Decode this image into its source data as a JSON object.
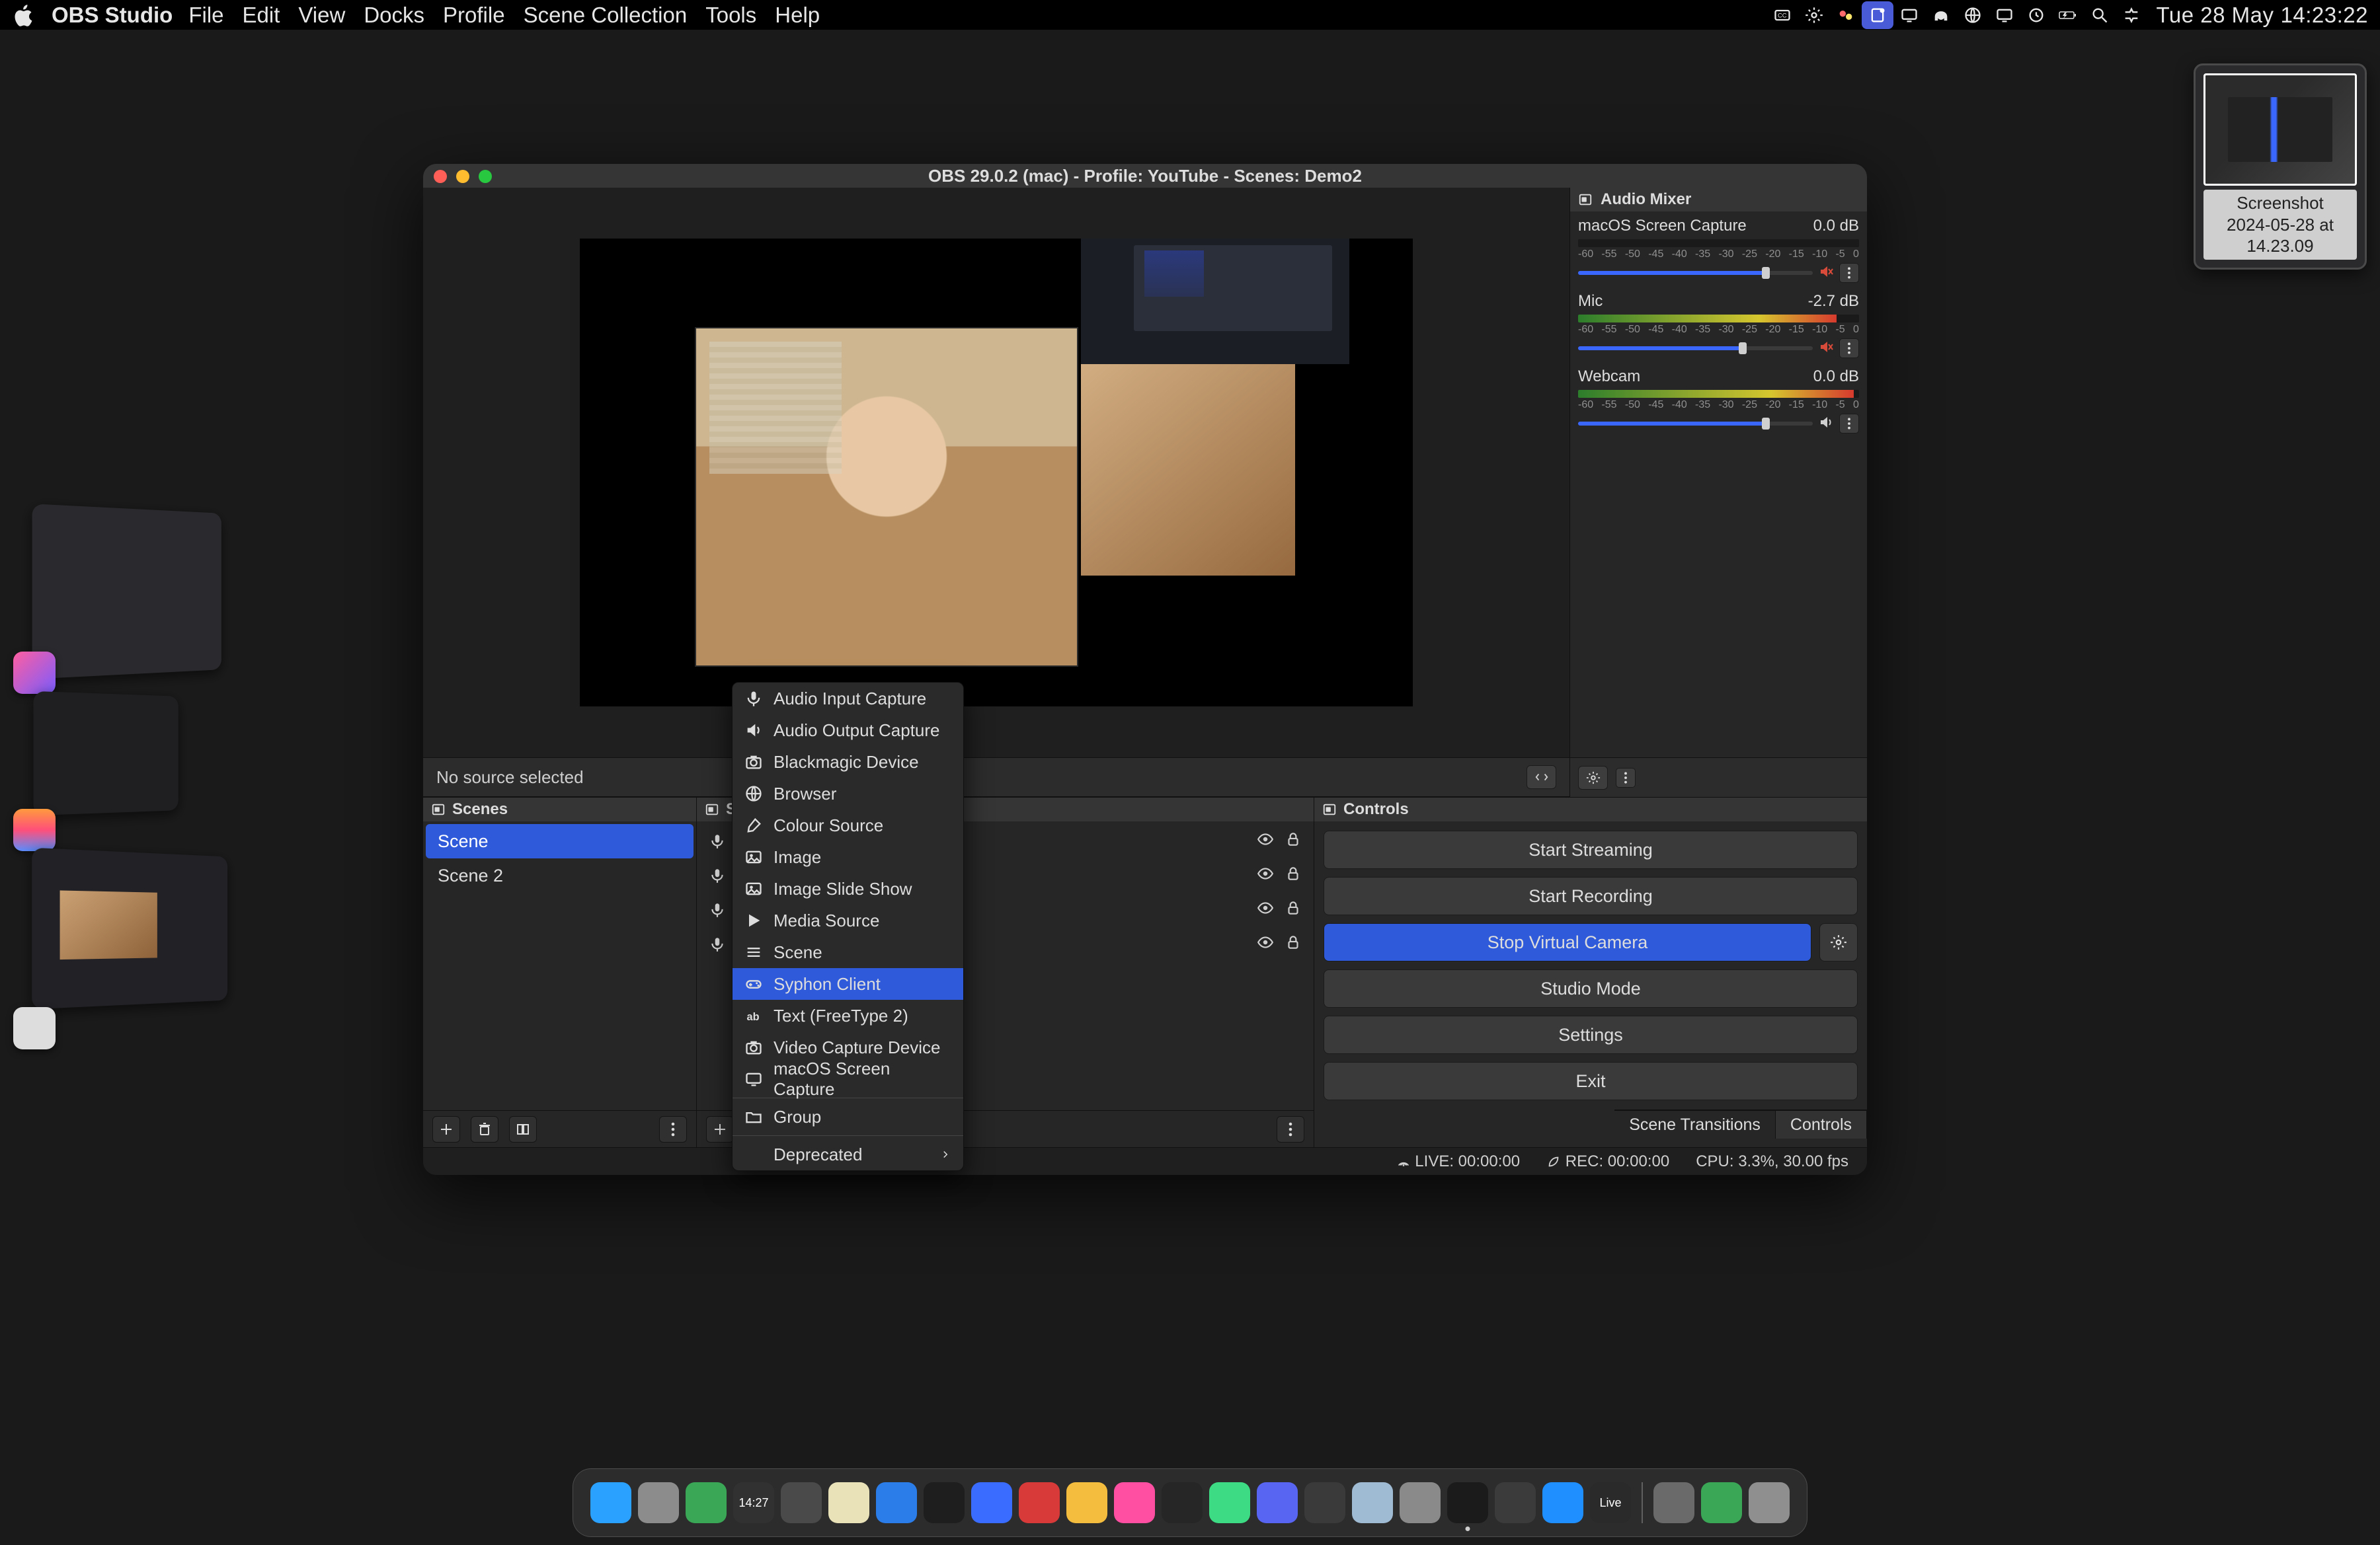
{
  "menubar": {
    "app": "OBS Studio",
    "menus": [
      "File",
      "Edit",
      "View",
      "Docks",
      "Profile",
      "Scene Collection",
      "Tools",
      "Help"
    ],
    "date": "Tue 28 May",
    "time": "14:23:22"
  },
  "screenshot_preview": {
    "line1": "Screenshot",
    "line2": "2024-05-28 at 14.23.09"
  },
  "obs": {
    "window_title": "OBS 29.0.2 (mac) - Profile: YouTube - Scenes: Demo2",
    "no_source": "No source selected",
    "mixer": {
      "title": "Audio Mixer",
      "scale": [
        "-60",
        "-55",
        "-50",
        "-45",
        "-40",
        "-35",
        "-30",
        "-25",
        "-20",
        "-15",
        "-10",
        "-5",
        "0"
      ],
      "channels": [
        {
          "name": "macOS Screen Capture",
          "db": "0.0 dB",
          "level": 0,
          "volume": 80,
          "muted": true
        },
        {
          "name": "Mic",
          "db": "-2.7 dB",
          "level": 92,
          "volume": 70,
          "muted": true
        },
        {
          "name": "Webcam",
          "db": "0.0 dB",
          "level": 98,
          "volume": 80,
          "muted": false
        }
      ]
    },
    "scenes": {
      "title": "Scenes",
      "items": [
        {
          "name": "Scene",
          "active": true
        },
        {
          "name": "Scene 2",
          "active": false
        }
      ]
    },
    "sources": {
      "title": "Sources",
      "rows": [
        {},
        {},
        {},
        {}
      ]
    },
    "controls": {
      "title": "Controls",
      "start_streaming": "Start Streaming",
      "start_recording": "Start Recording",
      "stop_vcam": "Stop Virtual Camera",
      "studio_mode": "Studio Mode",
      "settings": "Settings",
      "exit": "Exit",
      "tab_transitions": "Scene Transitions",
      "tab_controls": "Controls"
    },
    "status": {
      "live": "LIVE: 00:00:00",
      "rec": "REC: 00:00:00",
      "cpu": "CPU: 3.3%, 30.00 fps"
    }
  },
  "context_menu": {
    "items": [
      {
        "icon": "mic",
        "label": "Audio Input Capture"
      },
      {
        "icon": "speaker",
        "label": "Audio Output Capture"
      },
      {
        "icon": "camera",
        "label": "Blackmagic Device"
      },
      {
        "icon": "globe",
        "label": "Browser"
      },
      {
        "icon": "brush",
        "label": "Colour Source"
      },
      {
        "icon": "image",
        "label": "Image"
      },
      {
        "icon": "image",
        "label": "Image Slide Show"
      },
      {
        "icon": "play",
        "label": "Media Source"
      },
      {
        "icon": "scene",
        "label": "Scene"
      },
      {
        "icon": "gamepad",
        "label": "Syphon Client",
        "hover": true
      },
      {
        "icon": "text",
        "label": "Text (FreeType 2)"
      },
      {
        "icon": "camera",
        "label": "Video Capture Device"
      },
      {
        "icon": "monitor",
        "label": "macOS Screen Capture"
      }
    ],
    "group_label": "Group",
    "deprecated_label": "Deprecated"
  },
  "dock_apps": [
    {
      "name": "finder",
      "color": "#2aa1ff"
    },
    {
      "name": "launchpad",
      "color": "#8c8c8c"
    },
    {
      "name": "activity-monitor",
      "color": "#3aa757"
    },
    {
      "name": "clock-1427",
      "color": "#313131",
      "text": "14:27"
    },
    {
      "name": "app-lines",
      "color": "#4a4a4a"
    },
    {
      "name": "app-notes",
      "color": "#e9e2b8"
    },
    {
      "name": "vscode",
      "color": "#2b7de9"
    },
    {
      "name": "app-square",
      "color": "#1e1e1e"
    },
    {
      "name": "app-blue",
      "color": "#3a6cff"
    },
    {
      "name": "app-red",
      "color": "#d83a3a"
    },
    {
      "name": "app-yellow",
      "color": "#f5bd3d"
    },
    {
      "name": "app-pink",
      "color": "#ff4fa3"
    },
    {
      "name": "app-dark1",
      "color": "#262626"
    },
    {
      "name": "app-green",
      "color": "#3ddc84"
    },
    {
      "name": "discord",
      "color": "#5865f2"
    },
    {
      "name": "app-clapper",
      "color": "#3a3a3a"
    },
    {
      "name": "app-light",
      "color": "#9fbad3"
    },
    {
      "name": "settings",
      "color": "#8a8a8a"
    },
    {
      "name": "obs",
      "color": "#1b1b1b",
      "running": true
    },
    {
      "name": "app-chat",
      "color": "#3b3b3b"
    },
    {
      "name": "appstore",
      "color": "#1f8fff"
    },
    {
      "name": "app-live",
      "color": "#2a2a2a",
      "text": "Live"
    }
  ],
  "dock_right": [
    {
      "name": "doc-stack",
      "color": "#6a6a6a"
    },
    {
      "name": "downloads",
      "color": "#3aa757"
    },
    {
      "name": "trash",
      "color": "#8f8f8f"
    }
  ]
}
